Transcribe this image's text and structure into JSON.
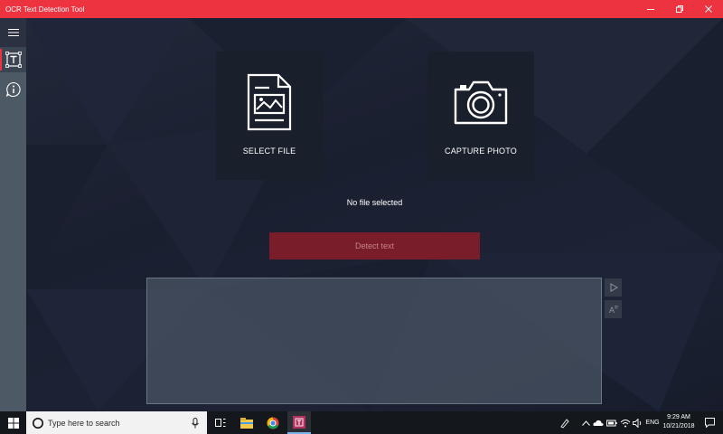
{
  "window": {
    "title": "OCR Text Detection Tool",
    "accent_color": "#ee3340",
    "buttons": [
      "minimize-icon",
      "maximize-icon",
      "close-icon"
    ]
  },
  "sidebar": {
    "menu_icon": "hamburger-icon",
    "items": [
      {
        "icon": "text-detection-icon",
        "active": true
      },
      {
        "icon": "info-icon",
        "active": false
      }
    ],
    "settings_icon": "gear-icon"
  },
  "main": {
    "select_file_label": "SELECT FILE",
    "capture_photo_label": "CAPTURE PHOTO",
    "status_text": "No file selected",
    "detect_button_label": "Detect text",
    "result_text": "",
    "result_actions": [
      "play-icon",
      "speak-text-icon"
    ]
  },
  "taskbar": {
    "search_placeholder": "Type here to search",
    "pinned": [
      "task-view-icon",
      "file-explorer-icon",
      "chrome-icon",
      "app-icon"
    ],
    "tray": {
      "language": "ENG",
      "time": "9:29 AM",
      "date": "10/21/2018"
    }
  }
}
